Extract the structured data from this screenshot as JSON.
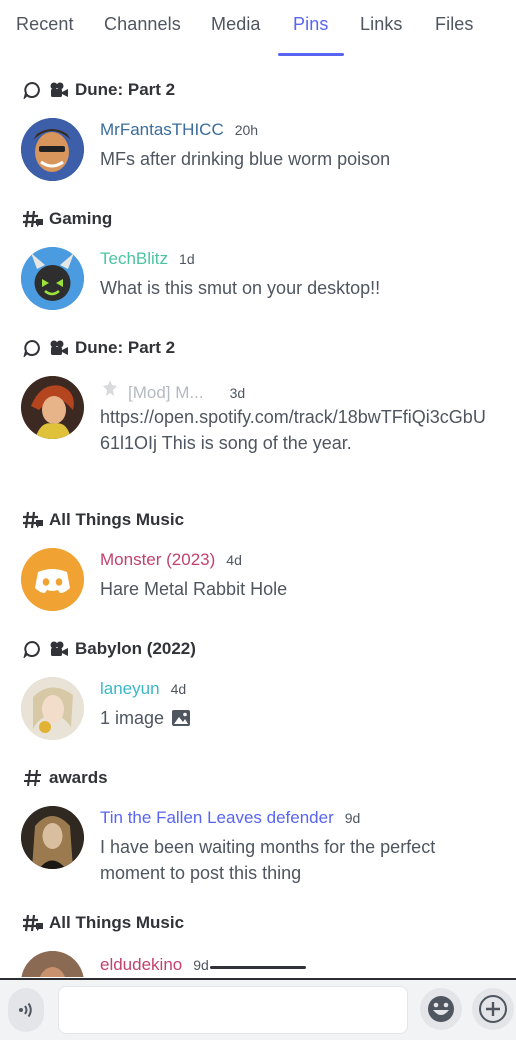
{
  "tabs": [
    {
      "label": "Recent"
    },
    {
      "label": "Channels"
    },
    {
      "label": "Media"
    },
    {
      "label": "Pins"
    },
    {
      "label": "Links"
    },
    {
      "label": "Files"
    }
  ],
  "active_tab": "Pins",
  "colors": {
    "accent": "#5865f2",
    "user_blue": "#3a6c9c",
    "user_teal": "#4cc4a0",
    "user_pink": "#c2426e",
    "user_cyan": "#3ab8c8",
    "user_purple": "#5865f2",
    "user_gray": "#b5bac1"
  },
  "pins": [
    {
      "channel_type": "thread-voice",
      "channel": "Dune: Part 2",
      "author": "MrFantasTHICC",
      "time": "20h",
      "message": "MFs after drinking blue worm poison"
    },
    {
      "channel_type": "text-thread",
      "channel": "Gaming",
      "author": "TechBlitz",
      "time": "1d",
      "message": "What is this smut on your desktop!!"
    },
    {
      "channel_type": "thread-voice",
      "channel": "Dune: Part 2",
      "author": "[Mod] M...",
      "time": "3d",
      "message": "https://open.spotify.com/track/18bwTFfiQi3cGbU61l1OIj This is song of the year."
    },
    {
      "channel_type": "text-thread",
      "channel": "All Things Music",
      "author": "Monster (2023)",
      "time": "4d",
      "message": "Hare Metal Rabbit Hole"
    },
    {
      "channel_type": "thread-voice",
      "channel": "Babylon (2022)",
      "author": "laneyun",
      "time": "4d",
      "message": "1 image"
    },
    {
      "channel_type": "text",
      "channel": "awards",
      "author": "Tin the Fallen Leaves defender",
      "time": "9d",
      "message": "I have been waiting months for the perfect moment to post this thing"
    },
    {
      "channel_type": "text-thread",
      "channel": "All Things Music",
      "author": "eldudekino",
      "time": "9d",
      "message": ""
    }
  ],
  "icons": {
    "thread": "thread-icon",
    "voice": "video-camera-icon",
    "text_thread": "hashtag-thread-icon",
    "text": "hashtag-icon",
    "image": "image-icon",
    "voice_bottom": "voice-icon",
    "emoji": "emoji-icon",
    "add": "plus-icon"
  }
}
